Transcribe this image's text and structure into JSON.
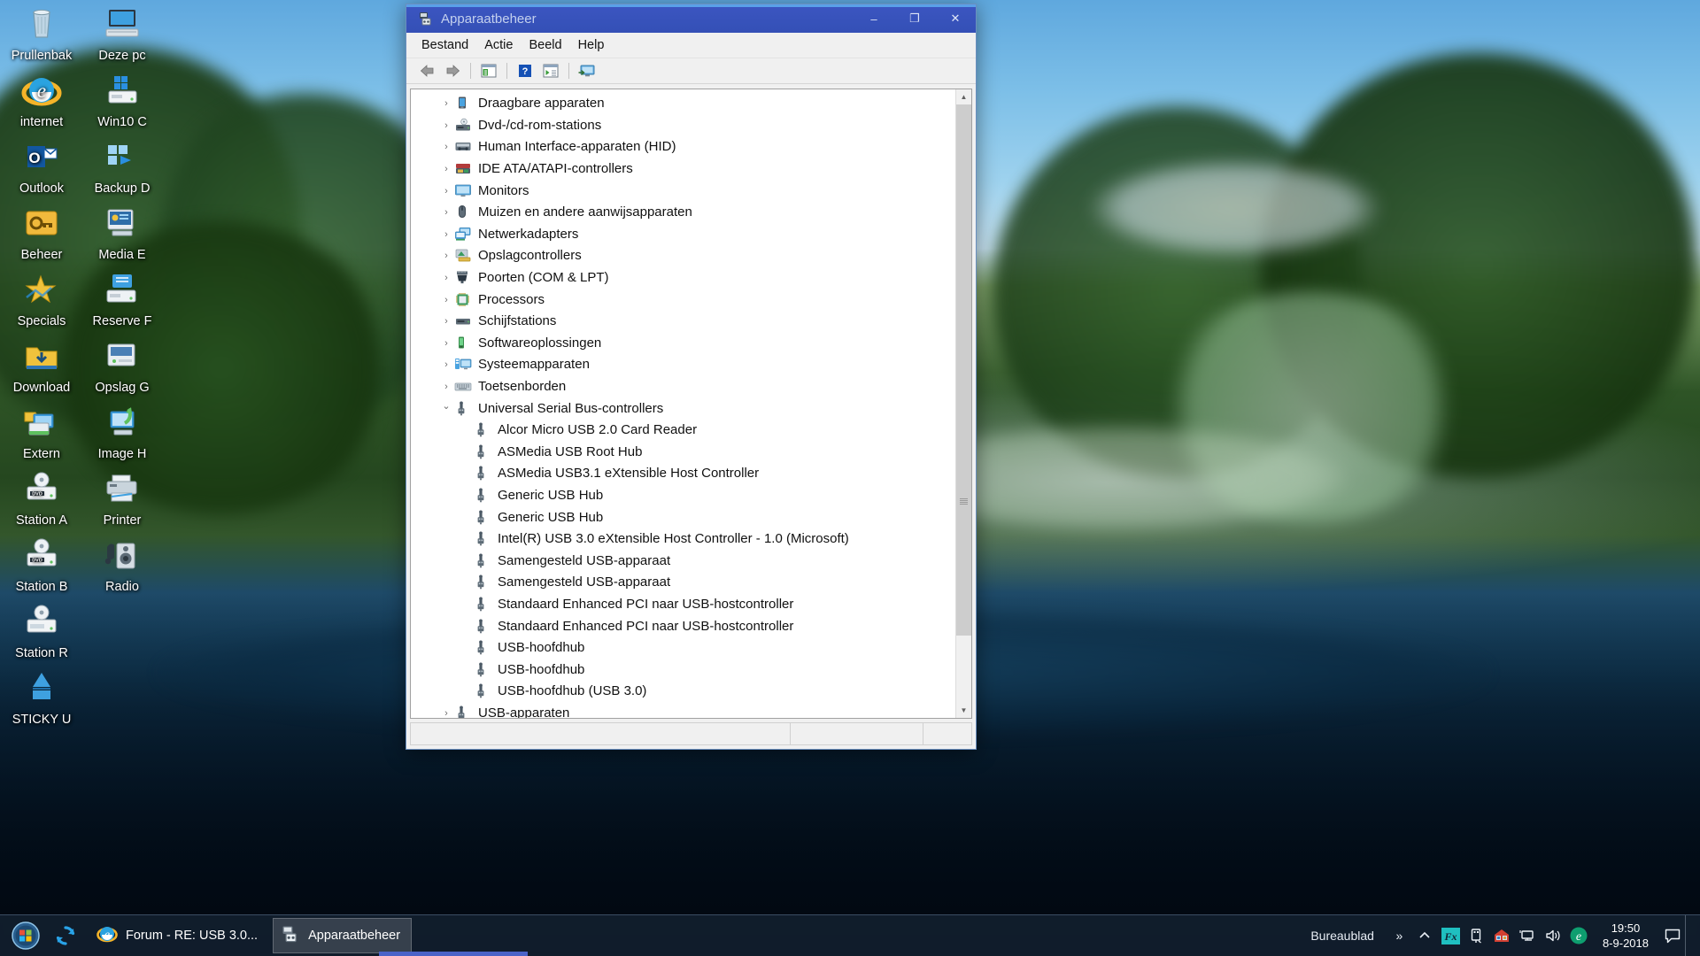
{
  "desktop": {
    "icons": [
      {
        "label": "Prullenbak",
        "icon": "recycle-bin-icon",
        "col": 0,
        "row": 0
      },
      {
        "label": "Deze pc",
        "icon": "this-pc-icon",
        "col": 1,
        "row": 0
      },
      {
        "label": "internet",
        "icon": "internet-explorer-icon",
        "col": 0,
        "row": 1
      },
      {
        "label": "Win10 C",
        "icon": "drive-win10c-icon",
        "col": 1,
        "row": 1
      },
      {
        "label": "Outlook",
        "icon": "outlook-icon",
        "col": 0,
        "row": 2
      },
      {
        "label": "Backup D",
        "icon": "backup-drive-icon",
        "col": 1,
        "row": 2
      },
      {
        "label": "Beheer",
        "icon": "management-key-icon",
        "col": 0,
        "row": 3
      },
      {
        "label": "Media E",
        "icon": "media-drive-icon",
        "col": 1,
        "row": 3
      },
      {
        "label": "Specials",
        "icon": "specials-folder-icon",
        "col": 0,
        "row": 4
      },
      {
        "label": "Reserve F",
        "icon": "reserve-drive-icon",
        "col": 1,
        "row": 4
      },
      {
        "label": "Download",
        "icon": "download-folder-icon",
        "col": 0,
        "row": 5
      },
      {
        "label": "Opslag G",
        "icon": "storage-drive-icon",
        "col": 1,
        "row": 5
      },
      {
        "label": "Extern",
        "icon": "external-drive-icon",
        "col": 0,
        "row": 6
      },
      {
        "label": "Image H",
        "icon": "image-drive-icon",
        "col": 1,
        "row": 6
      },
      {
        "label": "Station A",
        "icon": "dvd-drive-icon",
        "col": 0,
        "row": 7
      },
      {
        "label": "Printer",
        "icon": "printer-icon",
        "col": 1,
        "row": 7
      },
      {
        "label": "Station B",
        "icon": "dvd-drive-icon",
        "col": 0,
        "row": 8
      },
      {
        "label": "Radio",
        "icon": "radio-speaker-icon",
        "col": 1,
        "row": 8
      },
      {
        "label": "Station R",
        "icon": "disc-drive-icon",
        "col": 0,
        "row": 9
      },
      {
        "label": "STICKY U",
        "icon": "usb-stick-icon",
        "col": 0,
        "row": 10
      }
    ]
  },
  "window": {
    "title": "Apparaatbeheer",
    "title_icon": "device-manager-icon",
    "controls": {
      "minimize": "–",
      "maximize": "❐",
      "close": "✕"
    },
    "menu": [
      {
        "label": "Bestand",
        "name": "menu-bestand"
      },
      {
        "label": "Actie",
        "name": "menu-actie"
      },
      {
        "label": "Beeld",
        "name": "menu-beeld"
      },
      {
        "label": "Help",
        "name": "menu-help"
      }
    ],
    "toolbar": [
      {
        "name": "back-button",
        "icon": "back-arrow-icon"
      },
      {
        "name": "forward-button",
        "icon": "forward-arrow-icon"
      },
      {
        "name": "show-hide-console-tree-button",
        "icon": "console-tree-icon"
      },
      {
        "name": "help-button",
        "icon": "help-question-icon"
      },
      {
        "name": "properties-button",
        "icon": "properties-icon"
      },
      {
        "name": "scan-hardware-changes-button",
        "icon": "scan-monitor-icon"
      }
    ],
    "status": {
      "cell1": "",
      "cell2": "",
      "cell3": ""
    }
  },
  "tree": [
    {
      "label": "Draagbare apparaten",
      "icon": "portable-device-icon",
      "state": "collapsed",
      "level": 0
    },
    {
      "label": "Dvd-/cd-rom-stations",
      "icon": "dvd-drive-icon",
      "state": "collapsed",
      "level": 0
    },
    {
      "label": "Human Interface-apparaten (HID)",
      "icon": "hid-device-icon",
      "state": "collapsed",
      "level": 0
    },
    {
      "label": "IDE ATA/ATAPI-controllers",
      "icon": "ide-controller-icon",
      "state": "collapsed",
      "level": 0
    },
    {
      "label": "Monitors",
      "icon": "monitor-icon",
      "state": "collapsed",
      "level": 0
    },
    {
      "label": "Muizen en andere aanwijsapparaten",
      "icon": "mouse-icon",
      "state": "collapsed",
      "level": 0
    },
    {
      "label": "Netwerkadapters",
      "icon": "network-adapter-icon",
      "state": "collapsed",
      "level": 0
    },
    {
      "label": "Opslagcontrollers",
      "icon": "storage-controller-icon",
      "state": "collapsed",
      "level": 0
    },
    {
      "label": "Poorten (COM & LPT)",
      "icon": "port-icon",
      "state": "collapsed",
      "level": 0
    },
    {
      "label": "Processors",
      "icon": "processor-icon",
      "state": "collapsed",
      "level": 0
    },
    {
      "label": "Schijfstations",
      "icon": "disk-drive-icon",
      "state": "collapsed",
      "level": 0
    },
    {
      "label": "Softwareoplossingen",
      "icon": "software-device-icon",
      "state": "collapsed",
      "level": 0
    },
    {
      "label": "Systeemapparaten",
      "icon": "system-device-icon",
      "state": "collapsed",
      "level": 0
    },
    {
      "label": "Toetsenborden",
      "icon": "keyboard-icon",
      "state": "collapsed",
      "level": 0
    },
    {
      "label": "Universal Serial Bus-controllers",
      "icon": "usb-icon",
      "state": "expanded",
      "level": 0
    },
    {
      "label": "Alcor Micro USB 2.0 Card Reader",
      "icon": "usb-icon",
      "state": "leaf",
      "level": 1
    },
    {
      "label": "ASMedia USB Root Hub",
      "icon": "usb-icon",
      "state": "leaf",
      "level": 1
    },
    {
      "label": "ASMedia USB3.1 eXtensible Host Controller",
      "icon": "usb-icon",
      "state": "leaf",
      "level": 1
    },
    {
      "label": "Generic USB Hub",
      "icon": "usb-icon",
      "state": "leaf",
      "level": 1
    },
    {
      "label": "Generic USB Hub",
      "icon": "usb-icon",
      "state": "leaf",
      "level": 1
    },
    {
      "label": "Intel(R) USB 3.0 eXtensible Host Controller - 1.0 (Microsoft)",
      "icon": "usb-icon",
      "state": "leaf",
      "level": 1
    },
    {
      "label": "Samengesteld USB-apparaat",
      "icon": "usb-icon",
      "state": "leaf",
      "level": 1
    },
    {
      "label": "Samengesteld USB-apparaat",
      "icon": "usb-icon",
      "state": "leaf",
      "level": 1
    },
    {
      "label": "Standaard Enhanced PCI naar USB-hostcontroller",
      "icon": "usb-icon",
      "state": "leaf",
      "level": 1
    },
    {
      "label": "Standaard Enhanced PCI naar USB-hostcontroller",
      "icon": "usb-icon",
      "state": "leaf",
      "level": 1
    },
    {
      "label": "USB-hoofdhub",
      "icon": "usb-icon",
      "state": "leaf",
      "level": 1
    },
    {
      "label": "USB-hoofdhub",
      "icon": "usb-icon",
      "state": "leaf",
      "level": 1
    },
    {
      "label": "USB-hoofdhub (USB 3.0)",
      "icon": "usb-icon",
      "state": "leaf",
      "level": 1
    },
    {
      "label": "USB-apparaten",
      "icon": "usb-icon",
      "state": "collapsed",
      "level": 0
    }
  ],
  "taskbar": {
    "start_icon": "windows-start-orb-icon",
    "quick_launch": [
      {
        "name": "refresh-sync-icon",
        "label": ""
      }
    ],
    "tasks": [
      {
        "label": "Forum - RE: USB 3.0...",
        "icon": "internet-explorer-icon",
        "active": false
      },
      {
        "label": "Apparaatbeheer",
        "icon": "device-manager-icon",
        "active": true
      }
    ],
    "tray": {
      "show_desktop_label": "Bureaublad",
      "overflow_chevron": "»",
      "icons": [
        {
          "name": "hidden-icons-chevron-icon",
          "glyph": "∧"
        },
        {
          "name": "fx-app-icon",
          "glyph": "Fx"
        },
        {
          "name": "safely-remove-hardware-icon",
          "glyph": ""
        },
        {
          "name": "security-alert-icon",
          "glyph": ""
        },
        {
          "name": "network-icon",
          "glyph": ""
        },
        {
          "name": "volume-icon",
          "glyph": ""
        },
        {
          "name": "edge-browser-icon",
          "glyph": "e"
        }
      ],
      "clock_time": "19:50",
      "clock_date": "8-9-2018",
      "action_center_icon": "action-center-icon"
    }
  },
  "colors": {
    "titlebar": "#3450b6",
    "titlebar_top": "#5aa0e8",
    "accent": "#0078d7",
    "taskbar": "rgba(22,38,54,0.72)"
  }
}
